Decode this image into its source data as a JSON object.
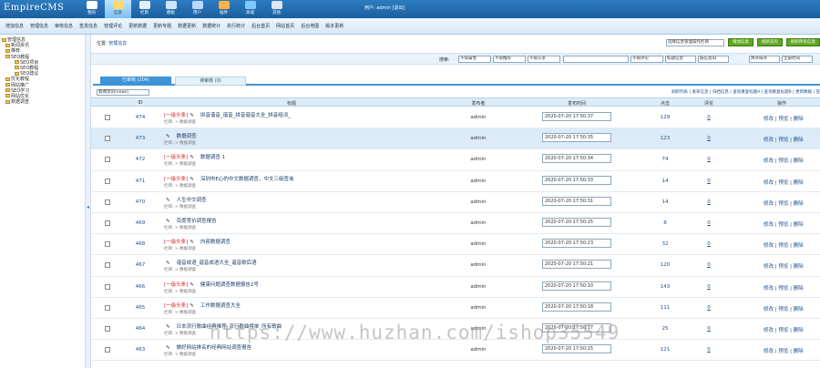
{
  "app": {
    "logo": "EmpireCMS"
  },
  "topnav": [
    {
      "label": "我的",
      "icon": "home-icon"
    },
    {
      "label": "信息",
      "icon": "edit-icon",
      "active": true
    },
    {
      "label": "栏目",
      "icon": "folder-icon"
    },
    {
      "label": "模板",
      "icon": "template-icon"
    },
    {
      "label": "用户",
      "icon": "user-icon"
    },
    {
      "label": "插件",
      "icon": "plugin-icon"
    },
    {
      "label": "商城",
      "icon": "shop-icon"
    },
    {
      "label": "其他",
      "icon": "gear-icon"
    }
  ],
  "userinfo": "用户: admin [退出]",
  "subnav": [
    "增加信息",
    "管理信息",
    "审核信息",
    "签发信息",
    "管理评论",
    "更新数据",
    "更新专题",
    "数据更新",
    "数据统计",
    "执行统计",
    "后台首页",
    "网站首页",
    "后台地图",
    "版本更新"
  ],
  "sidebar": {
    "items": [
      "管理信息",
      "新闻资讯",
      "推荐",
      "SEO教程",
      "SEO项目",
      "SEO教程",
      "SEO建议",
      "优化教程",
      "网站推广",
      "SEO学习",
      "网站优化",
      "数据调查"
    ]
  },
  "main": {
    "breadcrumb_prefix": "位置:",
    "breadcrumb_link": "管理信息",
    "action_select": "选择信息管理操作栏目",
    "buttons": [
      "增加信息",
      "刷新首页",
      "刷新所有信息"
    ],
    "filter": {
      "label": "搜索:",
      "selects": [
        "不限属性",
        "不限推荐",
        "不限头条"
      ],
      "selects2": [
        "不限评论",
        "标题信息",
        "按信息ID",
        "降序排序",
        "全部时间"
      ]
    },
    "tabs": {
      "active": "已审核 (204)",
      "inactive": "待审核 (0)"
    },
    "list_select": "新闻资讯(news)",
    "list_links": "刷新列表 | 发布信息 | 归档信息 | 查询重复标题A | 查询重复标题B | 更新数据 | 签",
    "headers": {
      "id": "ID",
      "title": "标题",
      "publisher": "发布者",
      "time": "发布时间",
      "clicks": "点击",
      "comments": "评论",
      "ops": "操作"
    },
    "rows": [
      {
        "id": "474",
        "tag": "[一级头条]",
        "title": "拼音谐音_谐音_拼音谐音大全_拼音组词_",
        "cat": "栏目: > 数据调查",
        "pub": "admin",
        "time": "2020-07-20 17:50:37",
        "clicks": "129",
        "comments": "0",
        "ops": "修改 | 预览 | 删除"
      },
      {
        "id": "473",
        "tag": "",
        "title": "数据调查",
        "cat": "栏目: > 数据调查",
        "pub": "admin",
        "time": "2020-07-20 17:50:35",
        "clicks": "123",
        "comments": "0",
        "ops": "修改 | 预览 | 删除"
      },
      {
        "id": "472",
        "tag": "[一级头条]",
        "title": "数据调查 1",
        "cat": "栏目: > 数据调查",
        "pub": "admin",
        "time": "2020-07-20 17:50:34",
        "clicks": "74",
        "comments": "0",
        "ops": "修改 | 预览 | 删除"
      },
      {
        "id": "471",
        "tag": "[一级头条]",
        "title": "深圳市E心的中文数据调查，中文三级查询",
        "cat": "栏目: > 数据调查",
        "pub": "admin",
        "time": "2020-07-20 17:50:33",
        "clicks": "14",
        "comments": "0",
        "ops": "修改 | 预览 | 删除"
      },
      {
        "id": "470",
        "tag": "",
        "title": "人生中文调查",
        "cat": "栏目: > 数据调查",
        "pub": "admin",
        "time": "2020-07-20 17:50:31",
        "clicks": "14",
        "comments": "0",
        "ops": "修改 | 预览 | 删除"
      },
      {
        "id": "469",
        "tag": "",
        "title": "百度竞价调查报告",
        "cat": "栏目: > 数据调查",
        "pub": "admin",
        "time": "2020-07-20 17:50:25",
        "clicks": "8",
        "comments": "0",
        "ops": "修改 | 预览 | 删除"
      },
      {
        "id": "468",
        "tag": "[一级头条]",
        "title": "内容数据调查",
        "cat": "栏目: > 数据调查",
        "pub": "admin",
        "time": "2020-07-20 17:50:23",
        "clicks": "32",
        "comments": "0",
        "ops": "修改 | 预览 | 删除"
      },
      {
        "id": "467",
        "tag": "",
        "title": "谐音成语_谐音成语大全_谐音歇后语",
        "cat": "栏目: > 数据调查",
        "pub": "admin",
        "time": "2020-07-20 17:50:21",
        "clicks": "120",
        "comments": "0",
        "ops": "修改 | 预览 | 删除"
      },
      {
        "id": "466",
        "tag": "[一级头条]",
        "title": "健康问题调查数据报告2号",
        "cat": "栏目: > 数据调查",
        "pub": "admin",
        "time": "2020-07-20 17:50:10",
        "clicks": "143",
        "comments": "0",
        "ops": "修改 | 预览 | 删除"
      },
      {
        "id": "465",
        "tag": "[一级头条]",
        "title": "工作数据调查大全",
        "cat": "栏目: > 数据调查",
        "pub": "admin",
        "time": "2020-07-20 17:50:18",
        "clicks": "111",
        "comments": "0",
        "ops": "修改 | 预览 | 删除"
      },
      {
        "id": "464",
        "tag": "",
        "title": "日本流行歌曲经典推荐_流行歌曲榜单_所有歌曲",
        "cat": "栏目: > 数据调查",
        "pub": "admin",
        "time": "2020-07-20 17:50:17",
        "clicks": "25",
        "comments": "0",
        "ops": "修改 | 预览 | 删除"
      },
      {
        "id": "463",
        "tag": "",
        "title": "做好网站排名的经典网站调查报告",
        "cat": "栏目: > 数据调查",
        "pub": "admin",
        "time": "2020-07-20 17:50:15",
        "clicks": "121",
        "comments": "0",
        "ops": "修改 | 预览 | 删除"
      }
    ]
  },
  "watermark": "https://www.huzhan.com/ishop35549",
  "colors": {
    "topbar": "#1b5f9f",
    "accent": "#3d93d6",
    "green_button": "#5ea722",
    "tag_red": "#dd2222"
  }
}
